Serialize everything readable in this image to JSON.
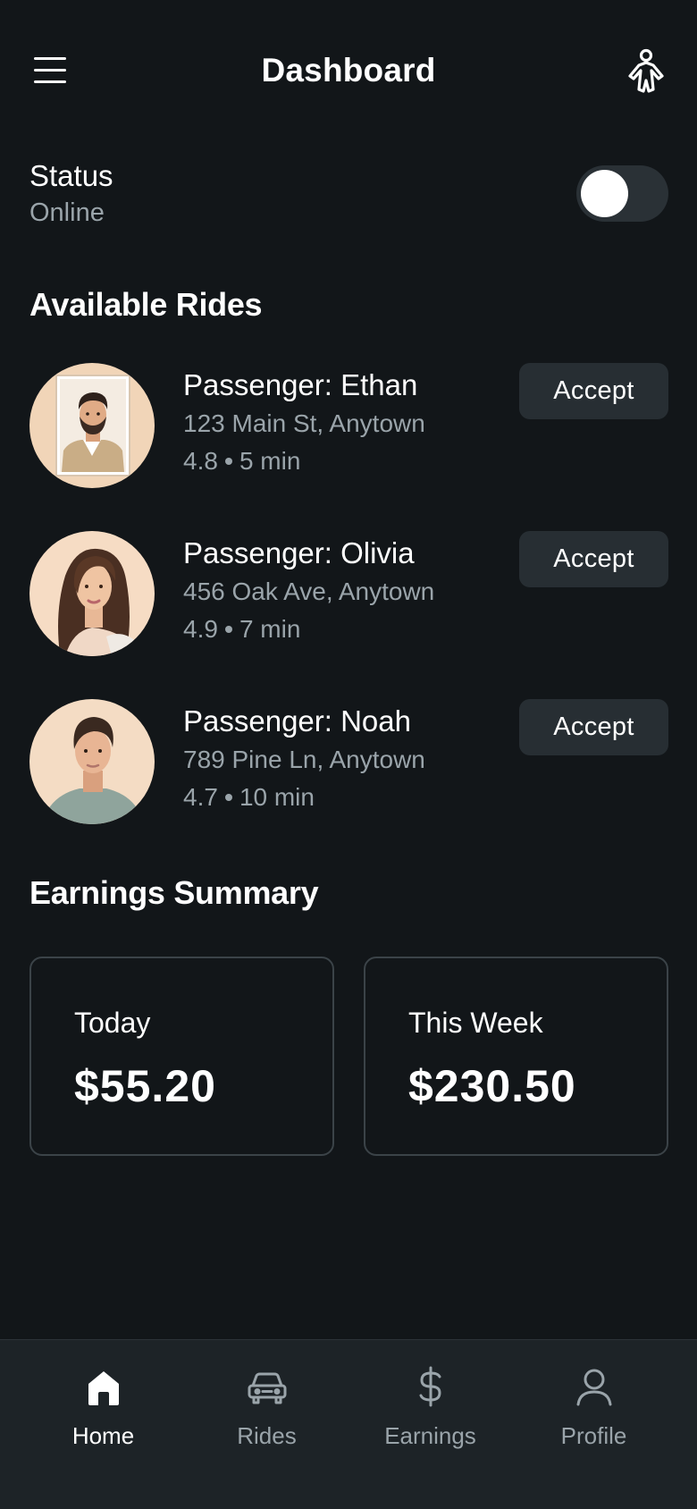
{
  "header": {
    "title": "Dashboard",
    "menu_icon": "hamburger-menu-icon",
    "right_icon": "person-icon"
  },
  "status": {
    "label": "Status",
    "value": "Online",
    "toggle_on": false
  },
  "rides_section": {
    "title": "Available Rides",
    "rides": [
      {
        "name": "Passenger: Ethan",
        "address": "123 Main St, Anytown",
        "rating": "4.8",
        "eta": "5 min",
        "action": "Accept"
      },
      {
        "name": "Passenger: Olivia",
        "address": "456 Oak Ave, Anytown",
        "rating": "4.9",
        "eta": "7 min",
        "action": "Accept"
      },
      {
        "name": "Passenger: Noah",
        "address": "789 Pine Ln, Anytown",
        "rating": "4.7",
        "eta": "10 min",
        "action": "Accept"
      }
    ]
  },
  "earnings_section": {
    "title": "Earnings Summary",
    "cards": [
      {
        "label": "Today",
        "value": "$55.20"
      },
      {
        "label": "This Week",
        "value": "$230.50"
      }
    ]
  },
  "bottom_nav": {
    "items": [
      {
        "label": "Home",
        "icon": "home-icon",
        "active": true
      },
      {
        "label": "Rides",
        "icon": "car-icon",
        "active": false
      },
      {
        "label": "Earnings",
        "icon": "dollar-icon",
        "active": false
      },
      {
        "label": "Profile",
        "icon": "user-icon",
        "active": false
      }
    ]
  },
  "colors": {
    "background": "#121619",
    "surface": "#272e33",
    "nav_background": "#1d2327",
    "muted_text": "#9aa4aa",
    "primary_text": "#ffffff"
  }
}
